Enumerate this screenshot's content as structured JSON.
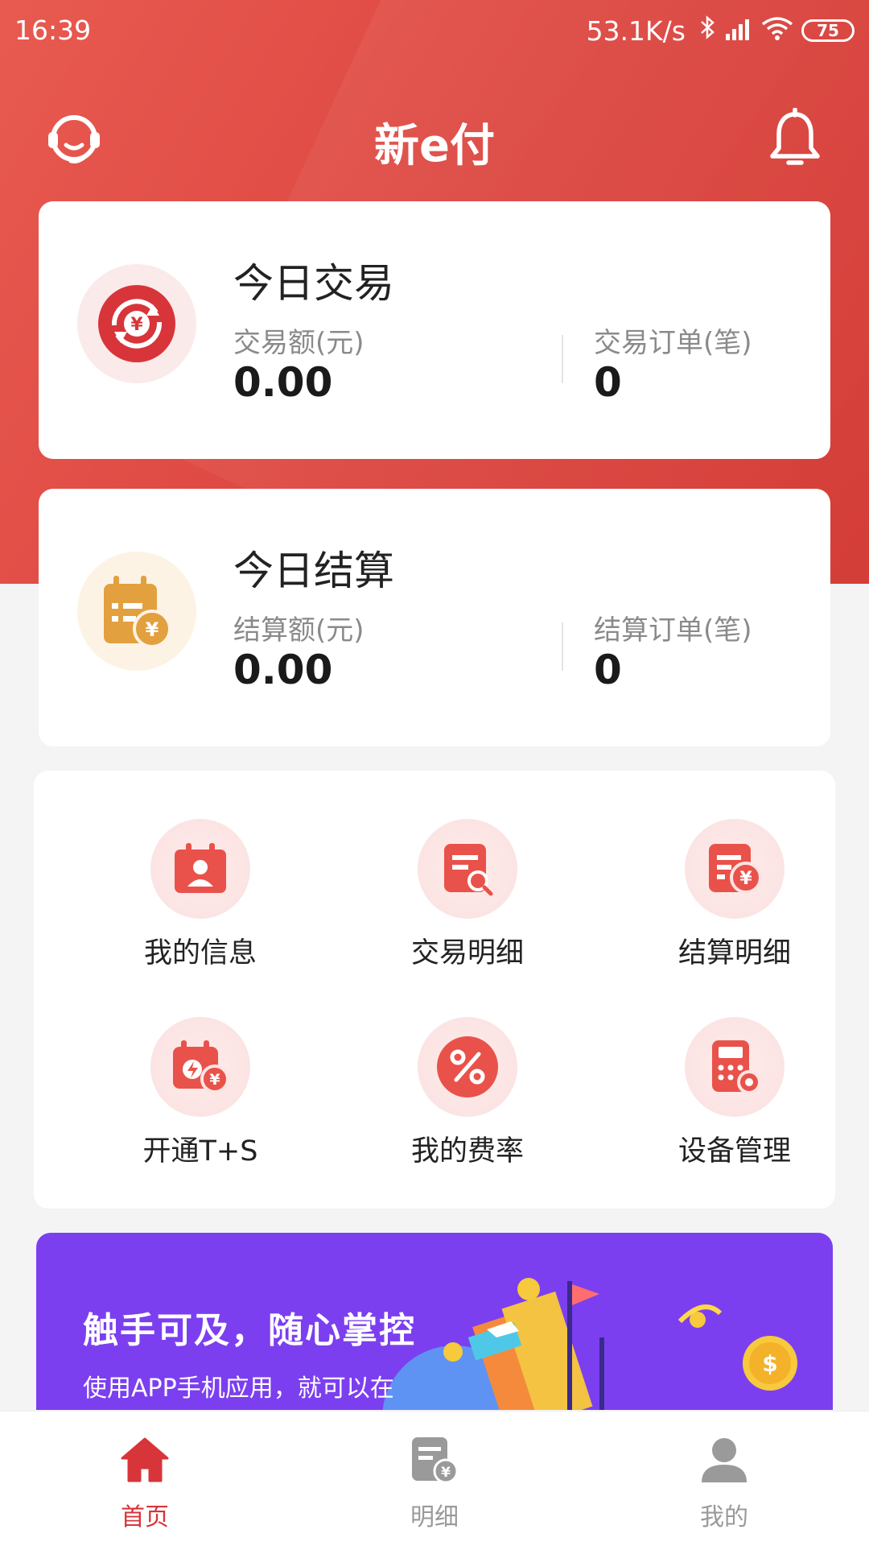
{
  "status": {
    "time": "16:39",
    "speed": "53.1K/s",
    "battery": "75"
  },
  "header": {
    "title": "新e付"
  },
  "today_trade": {
    "title": "今日交易",
    "amount_label": "交易额(元)",
    "amount_value": "0.00",
    "orders_label": "交易订单(笔)",
    "orders_value": "0",
    "icon": "yen-exchange-icon",
    "accent": "#d7353a"
  },
  "today_settle": {
    "title": "今日结算",
    "amount_label": "结算额(元)",
    "amount_value": "0.00",
    "orders_label": "结算订单(笔)",
    "orders_value": "0",
    "icon": "calendar-yen-icon",
    "accent": "#e2a03f"
  },
  "menu": [
    {
      "label": "我的信息",
      "icon": "profile-card-icon"
    },
    {
      "label": "交易明细",
      "icon": "trade-detail-icon"
    },
    {
      "label": "结算明细",
      "icon": "settle-detail-icon"
    },
    {
      "label": "开通T+S",
      "icon": "instant-settle-icon"
    },
    {
      "label": "我的费率",
      "icon": "percent-icon"
    },
    {
      "label": "设备管理",
      "icon": "pos-device-icon"
    }
  ],
  "banner": {
    "title": "触手可及，随心掌控",
    "subtitle": "使用APP手机应用，就可以在",
    "background": "#7b3ff0"
  },
  "tabs": [
    {
      "label": "首页",
      "icon": "home-icon",
      "active": true
    },
    {
      "label": "明细",
      "icon": "bill-icon",
      "active": false
    },
    {
      "label": "我的",
      "icon": "user-icon",
      "active": false
    }
  ],
  "colors": {
    "brand": "#d7353a",
    "tab_active": "#d7353a",
    "tab_inactive": "#9a9a9a"
  }
}
